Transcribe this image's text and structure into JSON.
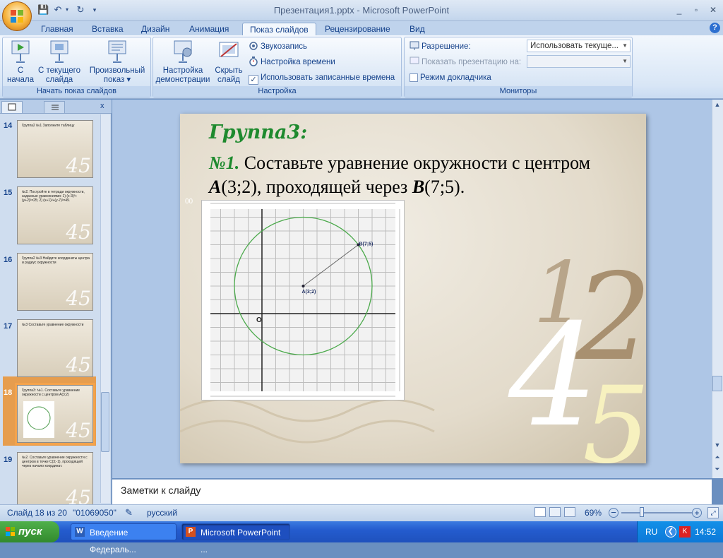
{
  "window": {
    "title": "Презентация1.pptx - Microsoft PowerPoint",
    "controls": [
      "_",
      "▫",
      "✕"
    ]
  },
  "qat": {
    "save_icon": "save-icon",
    "undo_icon": "undo-icon",
    "redo_icon": "redo-icon"
  },
  "tabs": [
    "Главная",
    "Вставка",
    "Дизайн",
    "Анимация",
    "Показ слайдов",
    "Рецензирование",
    "Вид"
  ],
  "active_tab": "Показ слайдов",
  "ribbon": {
    "start_group": {
      "label": "Начать показ слайдов",
      "btn1": "С",
      "btn1b": "начала",
      "btn2": "С текущего",
      "btn2b": "слайда",
      "btn3": "Произвольный",
      "btn3b": "показ ▾"
    },
    "setup_group": {
      "label": "Настройка",
      "btn1": "Настройка",
      "btn1b": "демонстрации",
      "btn2": "Скрыть",
      "btn2b": "слайд",
      "rec": "Звукозапись",
      "timing": "Настройка времени",
      "use_times": "Использовать записанные времена",
      "use_times_checked": true
    },
    "monitors_group": {
      "label": "Мониторы",
      "resolution_label": "Разрешение:",
      "resolution_value": "Использовать текуще...",
      "show_on_label": "Показать презентацию на:",
      "show_on_value": "",
      "presenter": "Режим докладчика",
      "presenter_checked": false
    }
  },
  "thumbnails": [
    {
      "num": "14",
      "text": "Группа2 №1 Заполните таблицу"
    },
    {
      "num": "15",
      "text": "№2. Постройте в тетради окружности, заданные уравнениями: 1) (x-3)²+(y+2)²=25; 2) (x+1)²+(y-7)²=49."
    },
    {
      "num": "16",
      "text": "Группа2 №3 Найдите координаты центра и радиус окружности"
    },
    {
      "num": "17",
      "text": "№3 Составьте уравнение окружности"
    },
    {
      "num": "18",
      "text": "Группа3: №1. Составьте уравнение окружности с центром A(3;2)"
    },
    {
      "num": "19",
      "text": "№2. Составьте уравнение окружности с центром в точке C(3;-1), проходящей через начало координат."
    }
  ],
  "slide": {
    "heading": "Группа3:",
    "num": "№1.",
    "text1": " Составьте уравнение окружности с центром ",
    "pointA": "A",
    "coordA": "(3;2), проходящей через ",
    "pointB": "B",
    "coordB": "(7;5).",
    "small_mark": "00",
    "decor": [
      "1",
      "2",
      "4",
      "5"
    ],
    "chart_labels": {
      "origin": "O",
      "a": "A(3;2)",
      "b": "B(7;5)"
    }
  },
  "chart_data": {
    "type": "scatter",
    "points": [
      {
        "label": "A(3;2)",
        "x": 3,
        "y": 2
      },
      {
        "label": "B(7;5)",
        "x": 7,
        "y": 5
      }
    ],
    "circle": {
      "cx": 3,
      "cy": 2,
      "r": 5
    },
    "xlim": [
      -3,
      10
    ],
    "ylim": [
      -6,
      8
    ]
  },
  "notes_placeholder": "Заметки к слайду",
  "statusbar": {
    "slide": "Слайд 18 из 20",
    "theme": "\"01069050\"",
    "lang": "русский",
    "zoom": "69%"
  },
  "taskbar": {
    "start": "пуск",
    "task1": "Введение Федераль...",
    "task2": "Microsoft PowerPoint ...",
    "lang": "RU",
    "time": "14:52"
  }
}
